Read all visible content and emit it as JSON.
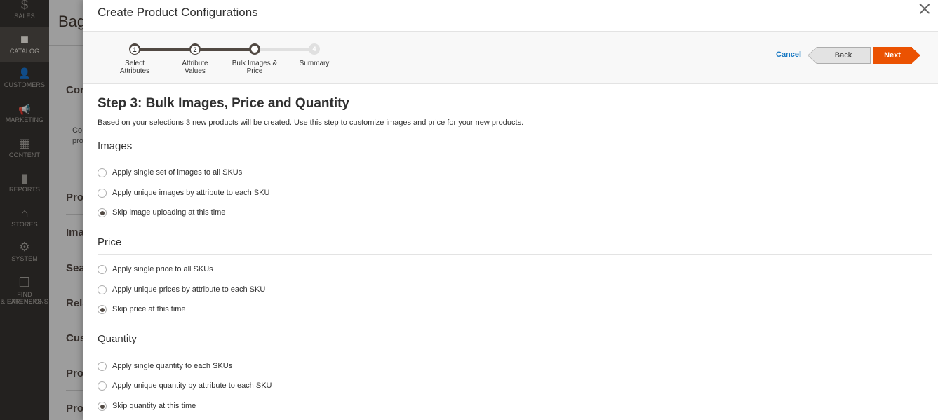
{
  "nav": {
    "items": [
      {
        "label": "SALES",
        "icon": "dollar-icon",
        "glyph": "$"
      },
      {
        "label": "CATALOG",
        "icon": "box-icon",
        "glyph": "◼"
      },
      {
        "label": "CUSTOMERS",
        "icon": "person-icon",
        "glyph": "👤"
      },
      {
        "label": "MARKETING",
        "icon": "megaphone-icon",
        "glyph": "📢"
      },
      {
        "label": "CONTENT",
        "icon": "layout-icon",
        "glyph": "▦"
      },
      {
        "label": "REPORTS",
        "icon": "bar-chart-icon",
        "glyph": "▮"
      },
      {
        "label": "STORES",
        "icon": "store-icon",
        "glyph": "⌂"
      },
      {
        "label": "SYSTEM",
        "icon": "gear-icon",
        "glyph": "⚙"
      },
      {
        "label_line1": "FIND PARTNERS",
        "label_line2": "& EXTENSIONS",
        "icon": "cube-icon",
        "glyph": "❒"
      }
    ],
    "active": "CATALOG"
  },
  "background_page": {
    "title": "Bag",
    "labels": [
      "Cor",
      "Pro",
      "Ima",
      "Sea",
      "Rela",
      "Cus",
      "Pro",
      "Pro"
    ],
    "small_text": [
      "Co",
      "pro"
    ]
  },
  "modal": {
    "title": "Create Product Configurations",
    "wizard": {
      "steps": [
        {
          "number": "1",
          "label_line1": "Select",
          "label_line2": "Attributes",
          "state": "done"
        },
        {
          "number": "2",
          "label_line1": "Attribute",
          "label_line2": "Values",
          "state": "done"
        },
        {
          "number": "3",
          "label_line1": "Bulk Images &",
          "label_line2": "Price",
          "state": "current"
        },
        {
          "number": "4",
          "label_line1": "Summary",
          "label_line2": "",
          "state": "future"
        }
      ],
      "cancel_label": "Cancel",
      "back_label": "Back",
      "next_label": "Next"
    },
    "heading": "Step 3: Bulk Images, Price and Quantity",
    "description": "Based on your selections 3 new products will be created. Use this step to customize images and price for your new products.",
    "sections": [
      {
        "title": "Images",
        "options": [
          {
            "label": "Apply single set of images to all SKUs",
            "checked": false
          },
          {
            "label": "Apply unique images by attribute to each SKU",
            "checked": false
          },
          {
            "label": "Skip image uploading at this time",
            "checked": true
          }
        ]
      },
      {
        "title": "Price",
        "options": [
          {
            "label": "Apply single price to all SKUs",
            "checked": false
          },
          {
            "label": "Apply unique prices by attribute to each SKU",
            "checked": false
          },
          {
            "label": "Skip price at this time",
            "checked": true
          }
        ]
      },
      {
        "title": "Quantity",
        "options": [
          {
            "label": "Apply single quantity to each SKUs",
            "checked": false
          },
          {
            "label": "Apply unique quantity by attribute to each SKU",
            "checked": false
          },
          {
            "label": "Skip quantity at this time",
            "checked": true
          }
        ]
      }
    ]
  },
  "colors": {
    "accent": "#eb5202",
    "link": "#1979c3",
    "nav_bg": "#373330",
    "step_done": "#514943"
  }
}
